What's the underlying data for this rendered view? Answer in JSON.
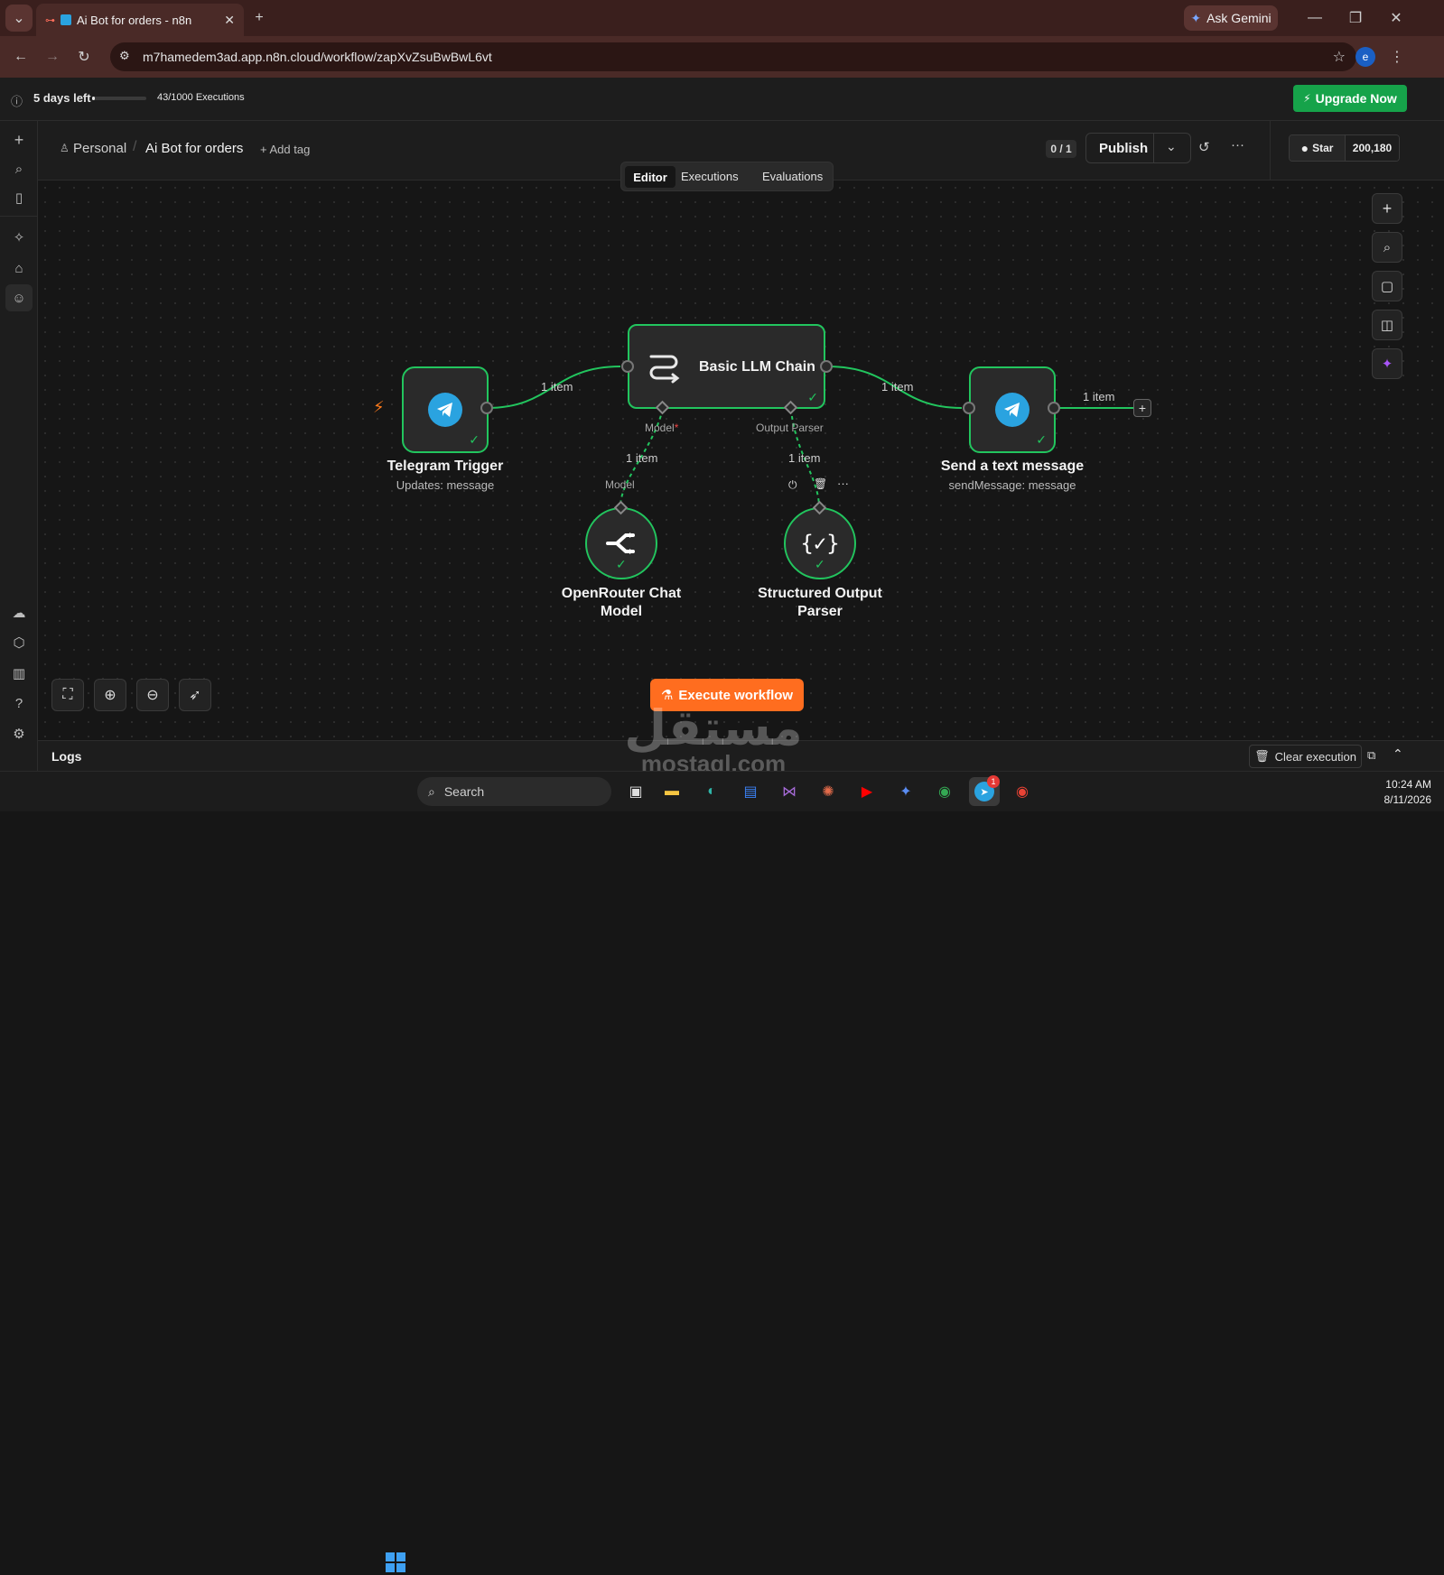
{
  "browser": {
    "tab_title": "Ai Bot for orders - n8n",
    "url": "m7hamedem3ad.app.n8n.cloud/workflow/zapXvZsuBwBwL6vt",
    "ask_gemini": "Ask Gemini",
    "profile_initial": "e"
  },
  "banner": {
    "trial": "5 days left",
    "executions": "43/1000 Executions",
    "upgrade": "Upgrade Now"
  },
  "header": {
    "project": "Personal",
    "workflow_name": "Ai Bot for orders",
    "add_tag": "+ Add tag",
    "version_counter": "0 / 1",
    "publish": "Publish",
    "github_star": "Star",
    "github_count": "200,180"
  },
  "tabs": [
    "Editor",
    "Executions",
    "Evaluations"
  ],
  "nodes": {
    "telegram_trigger": {
      "title": "Telegram Trigger",
      "subtitle": "Updates: message"
    },
    "llm_chain": {
      "title": "Basic LLM Chain"
    },
    "send_message": {
      "title": "Send a text message",
      "subtitle": "sendMessage: message"
    },
    "openrouter": {
      "title_line1": "OpenRouter Chat",
      "title_line2": "Model"
    },
    "parser": {
      "title_line1": "Structured Output",
      "title_line2": "Parser"
    }
  },
  "connections": {
    "trigger_to_chain": "1 item",
    "chain_to_send": "1 item",
    "send_out": "1 item",
    "model_link": "1 item",
    "parser_link": "1 item"
  },
  "ports": {
    "model": "Model",
    "model_required": "*",
    "output_parser": "Output Parser",
    "model_bottom": "Model"
  },
  "execute_button": "Execute workflow",
  "logs": {
    "label": "Logs",
    "clear": "Clear execution"
  },
  "watermark": {
    "arabic": "مستقل",
    "latin": "mostaql.com"
  },
  "taskbar": {
    "search": "Search",
    "time": "10:24 AM",
    "date": "8/11/2026",
    "telegram_badge": "1"
  },
  "colors": {
    "accent_green": "#22c55e",
    "upgrade_green": "#16a34a",
    "execute_orange": "#ff6d1f",
    "telegram_blue": "#2aa3e0"
  }
}
